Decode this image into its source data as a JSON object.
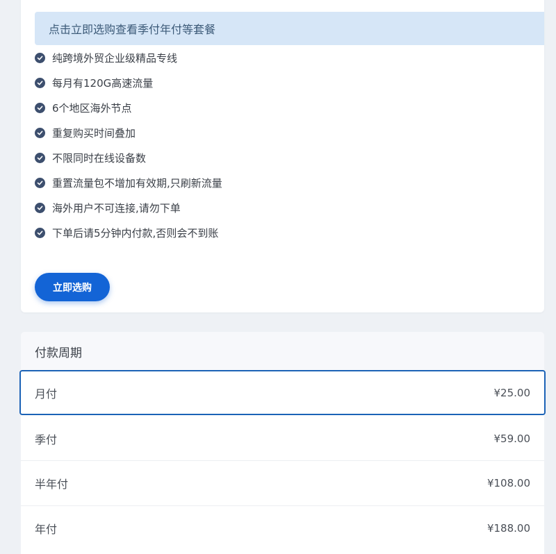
{
  "notice": "点击立即选购查看季付年付等套餐",
  "features": [
    "纯跨境外贸企业级精品专线",
    "每月有120G高速流量",
    "6个地区海外节点",
    "重复购买时间叠加",
    "不限同时在线设备数",
    "重置流量包不增加有效期,只刷新流量",
    "海外用户不可连接,请勿下单",
    "下单后请5分钟内付款,否则会不到账"
  ],
  "buy_button": "立即选购",
  "billing": {
    "title": "付款周期",
    "selected_index": 0,
    "options": [
      {
        "label": "月付",
        "price": "¥25.00"
      },
      {
        "label": "季付",
        "price": "¥59.00"
      },
      {
        "label": "半年付",
        "price": "¥108.00"
      },
      {
        "label": "年付",
        "price": "¥188.00"
      }
    ]
  },
  "colors": {
    "accent": "#1364d6",
    "notice_bg": "#d6e6f7",
    "check_icon": "#3d4f6e",
    "selected_border": "#1b62b6"
  }
}
